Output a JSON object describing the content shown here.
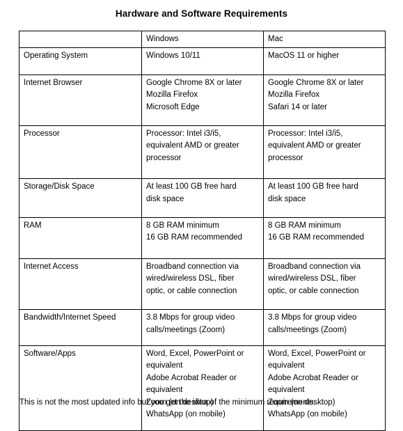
{
  "document": {
    "title": "Hardware and Software Requirements",
    "footer_note": "This is not the most updated info but you get the idea of the minimum requirements."
  },
  "table": {
    "headers": {
      "label_column": "",
      "windows": "Windows",
      "mac": "Mac"
    },
    "rows": [
      {
        "label": "Operating System",
        "windows": [
          "Windows 10/11"
        ],
        "mac": [
          "MacOS 11 or higher"
        ]
      },
      {
        "label": "Internet Browser",
        "windows": [
          "Google Chrome 8X or later",
          "Mozilla Firefox",
          "Microsoft Edge"
        ],
        "mac": [
          "Google Chrome 8X or later",
          "Mozilla Firefox",
          "Safari 14 or later"
        ]
      },
      {
        "label": "Processor",
        "windows": [
          "Processor: Intel i3/i5,",
          "equivalent AMD or greater",
          "processor"
        ],
        "mac": [
          "Processor: Intel i3/i5,",
          "equivalent AMD or greater",
          "processor"
        ]
      },
      {
        "label": "Storage/Disk Space",
        "windows": [
          "At least 100 GB free hard",
          "disk space"
        ],
        "mac": [
          "At least 100 GB free hard",
          "disk space"
        ]
      },
      {
        "label": "RAM",
        "windows": [
          "8 GB RAM minimum",
          "16 GB RAM recommended"
        ],
        "mac": [
          "8 GB RAM minimum",
          "16 GB RAM recommended"
        ]
      },
      {
        "label": "Internet Access",
        "windows": [
          "Broadband connection via",
          "wired/wireless DSL, fiber",
          "optic, or cable connection"
        ],
        "mac": [
          "Broadband connection via",
          "wired/wireless DSL, fiber",
          "optic, or cable connection"
        ]
      },
      {
        "label": "Bandwidth/Internet Speed",
        "windows": [
          "3.8 Mbps for group video",
          "calls/meetings (Zoom)"
        ],
        "mac": [
          "3.8 Mbps for group video",
          "calls/meetings (Zoom)"
        ]
      },
      {
        "label": "Software/Apps",
        "windows": [
          "Word, Excel, PowerPoint or",
          "equivalent",
          "Adobe Acrobat Reader or",
          "equivalent",
          "Zoom (on desktop)",
          "WhatsApp (on mobile)"
        ],
        "mac": [
          "Word, Excel, PowerPoint or",
          "equivalent",
          "Adobe Acrobat Reader or",
          "equivalent",
          "Zoom (on desktop)",
          "WhatsApp (on mobile)"
        ]
      }
    ],
    "row_bottom_padding": [
      1,
      1,
      2,
      1,
      2,
      1,
      3,
      4
    ]
  },
  "colors": {
    "page_background": "#ffffff",
    "text": "#000000",
    "table_border": "#000000"
  }
}
